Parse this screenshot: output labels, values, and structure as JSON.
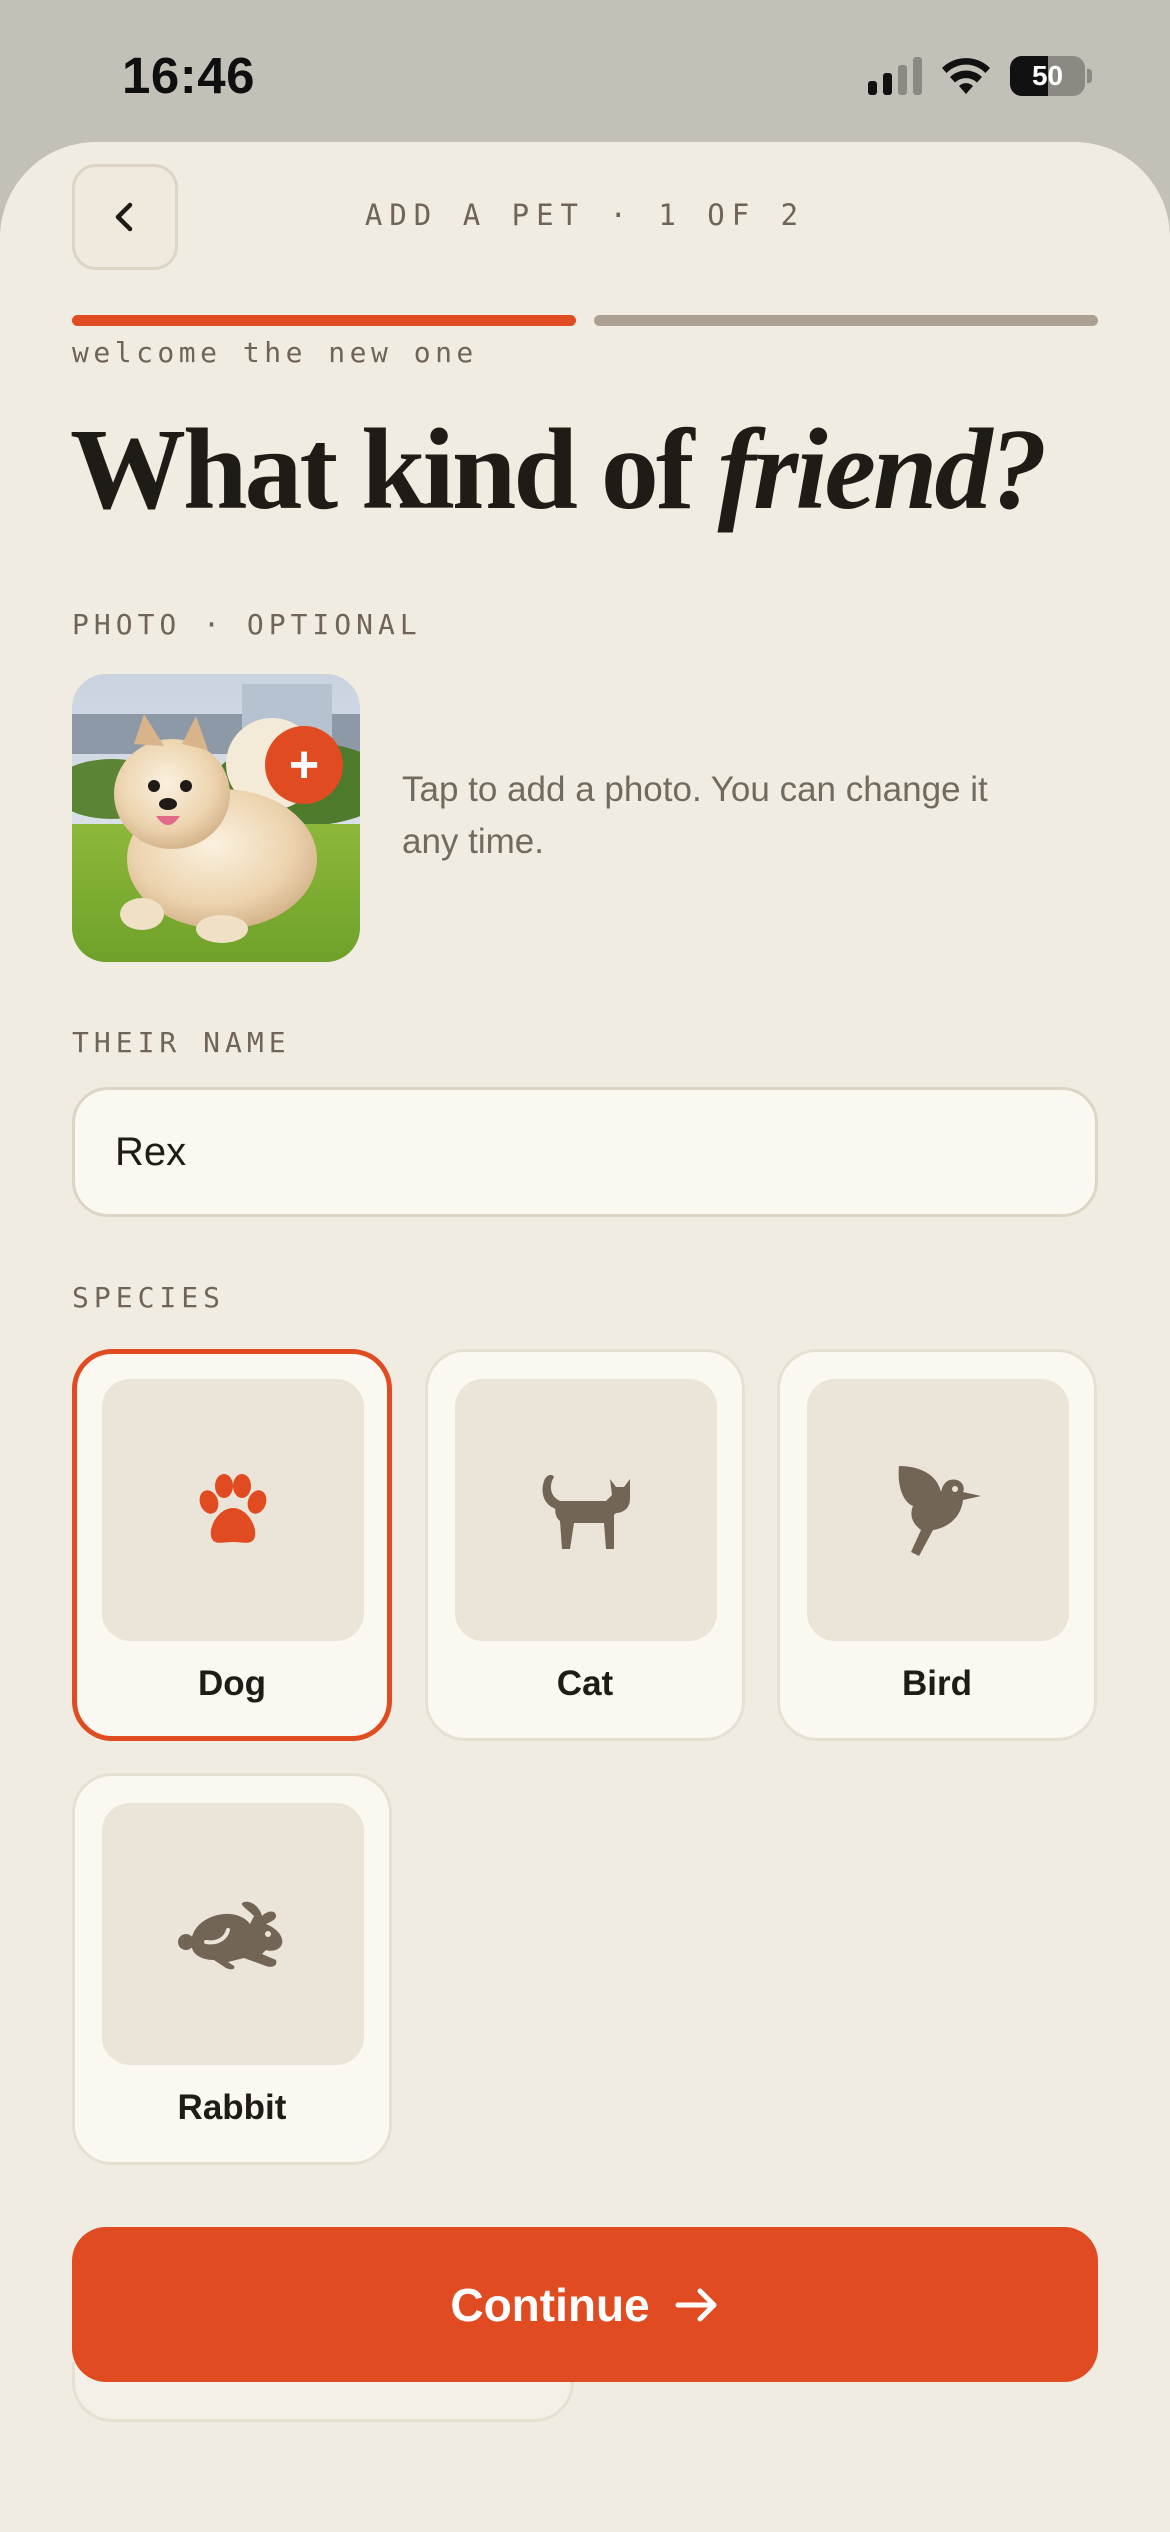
{
  "status_bar": {
    "time": "16:46",
    "battery": "50",
    "battery_level": 0.5
  },
  "header": {
    "step": "ADD A PET · 1 OF 2",
    "progress_current": 1,
    "progress_total": 2
  },
  "intro": {
    "eyebrow": "welcome the new one",
    "title_plain": "What kind of ",
    "title_italic": "friend?"
  },
  "photo": {
    "label": "PHOTO · OPTIONAL",
    "hint": "Tap to add a photo. You can change it any time.",
    "add_glyph": "+"
  },
  "name": {
    "label": "THEIR NAME",
    "value": "Rex"
  },
  "species": {
    "label": "SPECIES",
    "options": [
      {
        "label": "Dog",
        "icon": "paw-icon",
        "selected": true
      },
      {
        "label": "Cat",
        "icon": "cat-icon",
        "selected": false
      },
      {
        "label": "Bird",
        "icon": "bird-icon",
        "selected": false
      },
      {
        "label": "Rabbit",
        "icon": "rabbit-icon",
        "selected": false
      }
    ]
  },
  "footer": {
    "continue_label": "Continue"
  },
  "colors": {
    "accent": "#e04b21",
    "background": "#f0ece2",
    "muted_text": "#6f6457",
    "icon": "#736556"
  }
}
